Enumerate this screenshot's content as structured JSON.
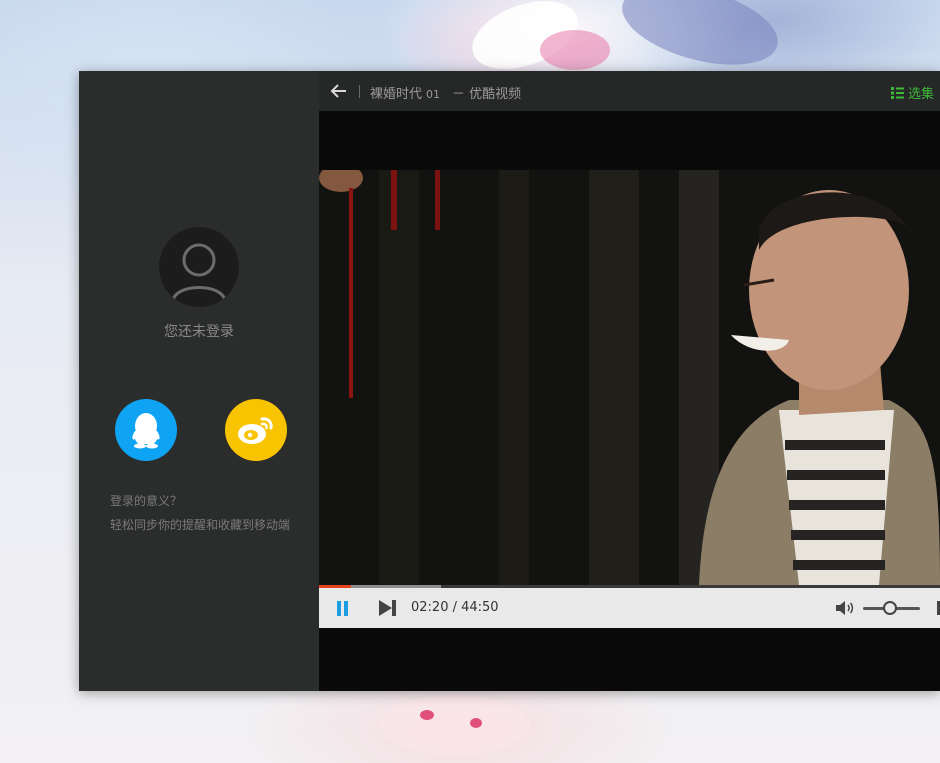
{
  "sidebar": {
    "login_status": "您还未登录",
    "login_buttons": [
      {
        "name": "QQ",
        "icon": "qq-icon",
        "color": "#0ea3f3"
      },
      {
        "name": "Weibo",
        "icon": "weibo-icon",
        "color": "#f8c300"
      }
    ],
    "info_question": "登录的意义？",
    "info_answer": "轻松同步你的提醒和收藏到移动端"
  },
  "titlebar": {
    "back_icon": "back-arrow-icon",
    "show_title": "裸婚时代",
    "episode": "01",
    "site": "－ 优酷视频",
    "episodes_label": "选集",
    "episodes_icon": "list-icon",
    "accent": "#3fb93a"
  },
  "player": {
    "time": "02:20 / 44:50",
    "played_fraction": 0.0522,
    "buffered_fraction": 0.197,
    "volume_fraction": 0.47,
    "progress_color": "#e8431a",
    "accent": "#1a9ee0"
  }
}
